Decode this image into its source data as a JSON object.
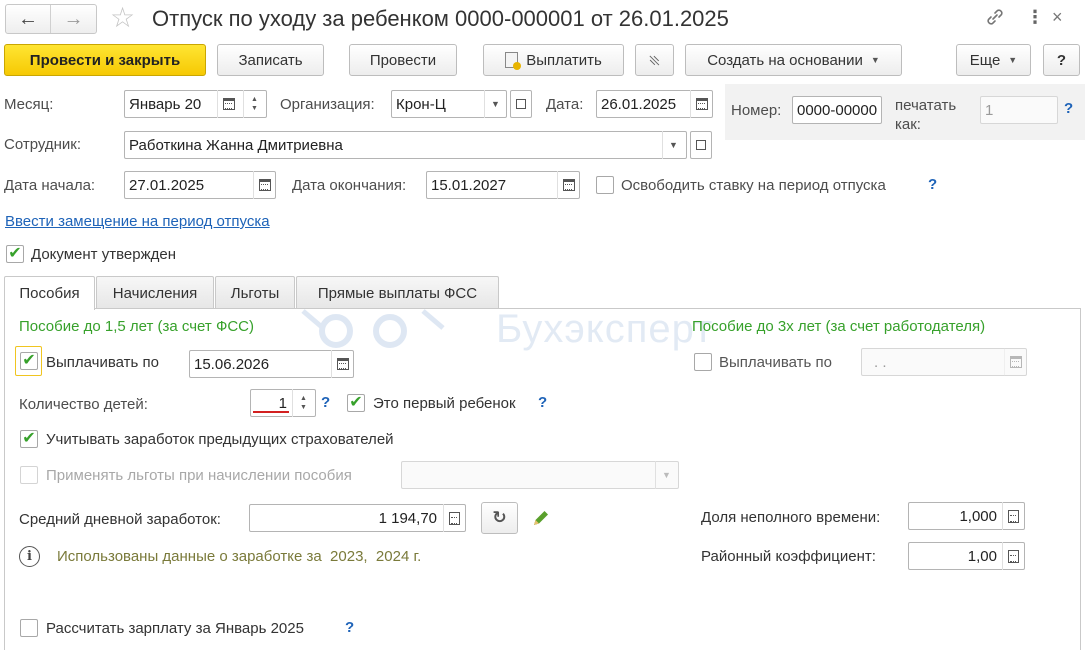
{
  "window": {
    "title": "Отпуск по уходу за ребенком 0000-000001 от 26.01.2025"
  },
  "toolbar": {
    "post_close": "Провести и закрыть",
    "save": "Записать",
    "post": "Провести",
    "pay": "Выплатить",
    "create_based": "Создать на основании",
    "more": "Еще",
    "help": "?"
  },
  "header": {
    "month_label": "Месяц:",
    "month_value": "Январь 20",
    "org_label": "Организация:",
    "org_value": "Крон-Ц",
    "date_label": "Дата:",
    "date_value": "26.01.2025",
    "number_label": "Номер:",
    "number_value": "0000-00000",
    "print_label_1": "печатать",
    "print_label_2": "как:",
    "print_value": "1",
    "employee_label": "Сотрудник:",
    "employee_value": "Работкина Жанна Дмитриевна",
    "start_label": "Дата начала:",
    "start_value": "27.01.2025",
    "end_label": "Дата окончания:",
    "end_value": "15.01.2027",
    "free_rate_label": "Освободить ставку на период отпуска",
    "replacement_link": "Ввести замещение на период отпуска",
    "approved_label": "Документ утвержден"
  },
  "tabs": [
    {
      "label": "Пособия",
      "active": true
    },
    {
      "label": "Начисления",
      "active": false
    },
    {
      "label": "Льготы",
      "active": false
    },
    {
      "label": "Прямые выплаты ФСС",
      "active": false
    }
  ],
  "benefits": {
    "left_title": "Пособие до 1,5 лет (за счет ФСС)",
    "right_title": "Пособие до 3х лет (за счет работодателя)",
    "pay_until_label": "Выплачивать по",
    "pay_until_value": "15.06.2026",
    "pay_until_right_label": "Выплачивать по",
    "pay_until_right_value": " .  .",
    "children_label": "Количество детей:",
    "children_value": "1",
    "first_child_label": "Это первый ребенок",
    "prev_insurers_label": "Учитывать заработок предыдущих страхователей",
    "apply_benefits_label": "Применять льготы при начислении пособия",
    "avg_earnings_label": "Средний дневной заработок:",
    "avg_earnings_value": "1 194,70",
    "info_text": "Использованы данные о заработке за  2023,  2024 г.",
    "part_time_label": "Доля неполного времени:",
    "part_time_value": "1,000",
    "regional_label": "Районный коэффициент:",
    "regional_value": "1,00",
    "calc_salary_label": "Рассчитать зарплату за Январь 2025"
  },
  "watermark": "Бухэксперт",
  "colors": {
    "accent_yellow": "#f6c903",
    "link_blue": "#1e63b8",
    "group_green": "#37a12b",
    "info_olive": "#7a7a3a"
  }
}
